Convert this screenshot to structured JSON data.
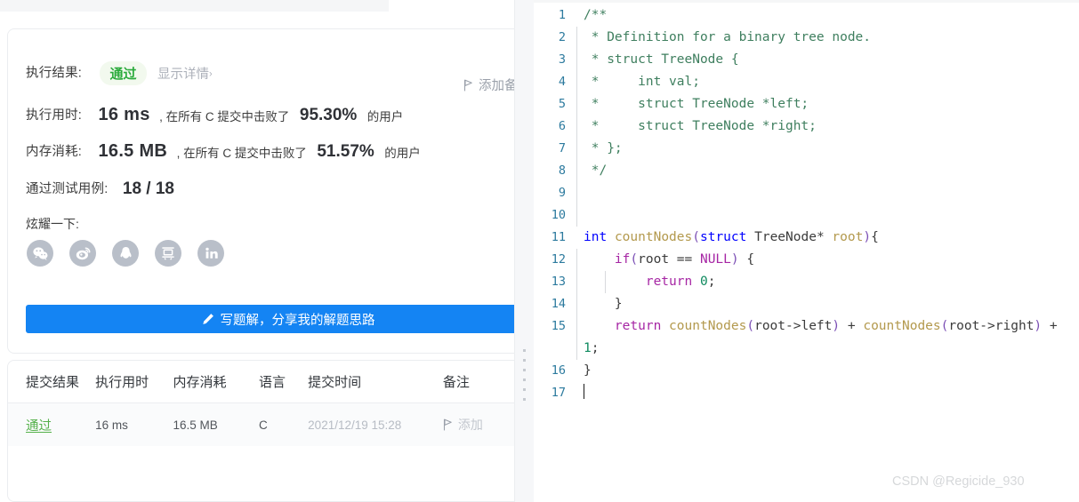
{
  "result_card": {
    "exec_result_label": "执行结果:",
    "status_badge": "通过",
    "show_detail": "显示详情",
    "show_detail_chevron": "›",
    "add_note": "添加备",
    "add_note_icon": "flag-icon",
    "runtime_label": "执行用时:",
    "runtime_value": "16 ms",
    "runtime_mid": ", 在所有 C 提交中击败了",
    "runtime_pct": "95.30%",
    "runtime_suffix": "的用户",
    "memory_label": "内存消耗:",
    "memory_value": "16.5 MB",
    "memory_mid": ", 在所有 C 提交中击败了",
    "memory_pct": "51.57%",
    "memory_suffix": "的用户",
    "cases_label": "通过测试用例:",
    "cases_value": "18 / 18",
    "share_label": "炫耀一下:",
    "social": [
      {
        "name": "wechat-share-icon",
        "title": "微信"
      },
      {
        "name": "weibo-share-icon",
        "title": "微博"
      },
      {
        "name": "qq-share-icon",
        "title": "QQ"
      },
      {
        "name": "douban-share-icon",
        "title": "豆瓣"
      },
      {
        "name": "linkedin-share-icon",
        "title": "LinkedIn"
      }
    ],
    "cta_label": "写题解，分享我的解题思路",
    "cta_icon": "pencil-icon",
    "accent_blue": "#1484f3",
    "pass_green": "#2bab3c"
  },
  "submissions": {
    "columns": [
      "提交结果",
      "执行用时",
      "内存消耗",
      "语言",
      "提交时间",
      "备注"
    ],
    "rows": [
      {
        "result": "通过",
        "runtime": "16 ms",
        "memory": "16.5 MB",
        "language": "C",
        "time": "2021/12/19 15:28",
        "note": "添加",
        "note_icon": "flag-icon"
      }
    ]
  },
  "editor": {
    "lines": [
      {
        "n": "1",
        "tokens": [
          {
            "t": "/**",
            "c": "k-cmt"
          }
        ]
      },
      {
        "n": "2",
        "guide": true,
        "tokens": [
          {
            "t": " * Definition for a binary tree node.",
            "c": "k-cmt"
          }
        ]
      },
      {
        "n": "3",
        "guide": true,
        "tokens": [
          {
            "t": " * struct TreeNode {",
            "c": "k-cmt"
          }
        ]
      },
      {
        "n": "4",
        "guide": true,
        "tokens": [
          {
            "t": " *     int val;",
            "c": "k-cmt"
          }
        ]
      },
      {
        "n": "5",
        "guide": true,
        "tokens": [
          {
            "t": " *     struct TreeNode *left;",
            "c": "k-cmt"
          }
        ]
      },
      {
        "n": "6",
        "guide": true,
        "tokens": [
          {
            "t": " *     struct TreeNode *right;",
            "c": "k-cmt"
          }
        ]
      },
      {
        "n": "7",
        "guide": true,
        "tokens": [
          {
            "t": " * };",
            "c": "k-cmt"
          }
        ]
      },
      {
        "n": "8",
        "guide": true,
        "tokens": [
          {
            "t": " */",
            "c": "k-cmt"
          }
        ]
      },
      {
        "n": "9",
        "guide": true,
        "tokens": []
      },
      {
        "n": "10",
        "guide": true,
        "tokens": []
      },
      {
        "n": "11",
        "tokens": [
          {
            "t": "int",
            "c": "k-kw"
          },
          {
            "t": " ",
            "c": "k-op"
          },
          {
            "t": "countNodes",
            "c": "k-fn"
          },
          {
            "t": "(",
            "c": "k-par"
          },
          {
            "t": "struct",
            "c": "k-kw"
          },
          {
            "t": " ",
            "c": "k-op"
          },
          {
            "t": "TreeNode*",
            "c": "k-id"
          },
          {
            "t": " ",
            "c": "k-op"
          },
          {
            "t": "root",
            "c": "k-fn"
          },
          {
            "t": ")",
            "c": "k-par"
          },
          {
            "t": "{",
            "c": "k-op"
          }
        ]
      },
      {
        "n": "12",
        "guide": true,
        "tokens": [
          {
            "t": "    ",
            "c": "k-op"
          },
          {
            "t": "if",
            "c": "k-ctl"
          },
          {
            "t": "(",
            "c": "k-par"
          },
          {
            "t": "root",
            "c": "k-id"
          },
          {
            "t": " == ",
            "c": "k-op"
          },
          {
            "t": "NULL",
            "c": "k-ctl"
          },
          {
            "t": ")",
            "c": "k-par"
          },
          {
            "t": " {",
            "c": "k-op"
          }
        ]
      },
      {
        "n": "13",
        "guide": true,
        "guide2": true,
        "tokens": [
          {
            "t": "        ",
            "c": "k-op"
          },
          {
            "t": "return",
            "c": "k-ctl"
          },
          {
            "t": " ",
            "c": "k-op"
          },
          {
            "t": "0",
            "c": "k-num"
          },
          {
            "t": ";",
            "c": "k-op"
          }
        ]
      },
      {
        "n": "14",
        "guide": true,
        "tokens": [
          {
            "t": "    }",
            "c": "k-op"
          }
        ]
      },
      {
        "n": "15",
        "guide": true,
        "tokens": [
          {
            "t": "    ",
            "c": "k-op"
          },
          {
            "t": "return",
            "c": "k-ctl"
          },
          {
            "t": " ",
            "c": "k-op"
          },
          {
            "t": "countNodes",
            "c": "k-fn"
          },
          {
            "t": "(",
            "c": "k-par"
          },
          {
            "t": "root->left",
            "c": "k-id"
          },
          {
            "t": ")",
            "c": "k-par"
          },
          {
            "t": " + ",
            "c": "k-op"
          },
          {
            "t": "countNodes",
            "c": "k-fn"
          },
          {
            "t": "(",
            "c": "k-par"
          },
          {
            "t": "root->right",
            "c": "k-id"
          },
          {
            "t": ")",
            "c": "k-par"
          },
          {
            "t": " + ",
            "c": "k-op"
          },
          {
            "t": "1",
            "c": "k-num"
          },
          {
            "t": ";",
            "c": "k-op"
          }
        ]
      },
      {
        "n": "16",
        "tokens": [
          {
            "t": "}",
            "c": "k-op"
          }
        ]
      },
      {
        "n": "17",
        "caret": true,
        "tokens": []
      }
    ]
  },
  "watermark": "CSDN @Regicide_930"
}
